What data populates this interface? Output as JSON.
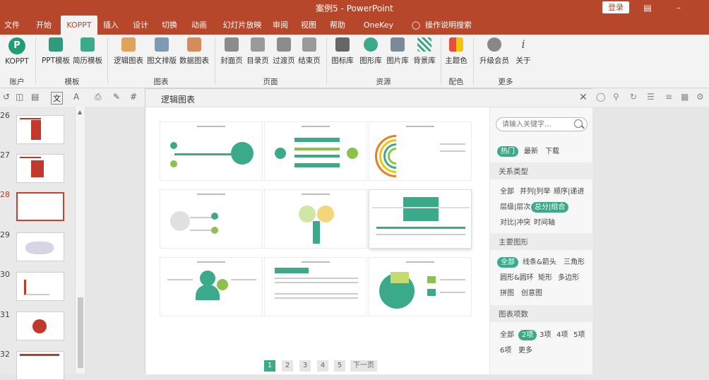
{
  "titlebar": {
    "title": "案例5 - PowerPoint",
    "login": "登录"
  },
  "tabs": [
    {
      "label": "文件"
    },
    {
      "label": "开始"
    },
    {
      "label": "KOPPT"
    },
    {
      "label": "插入"
    },
    {
      "label": "设计"
    },
    {
      "label": "切换"
    },
    {
      "label": "动画"
    },
    {
      "label": "幻灯片放映"
    },
    {
      "label": "审阅"
    },
    {
      "label": "视图"
    },
    {
      "label": "帮助"
    },
    {
      "label": "OneKey Lite"
    },
    {
      "label": "操作说明搜索"
    }
  ],
  "ribbon": {
    "account": {
      "btn": "KOPPT",
      "group": "账户"
    },
    "template": {
      "btn1": "PPT模板",
      "btn2": "简历模板",
      "group": "模板"
    },
    "chart": {
      "btn1": "逻辑图表",
      "btn2": "图文排版",
      "btn3": "数据图表",
      "group": "图表"
    },
    "page": {
      "btn1": "封面页",
      "btn2": "目录页",
      "btn3": "过渡页",
      "btn4": "结束页",
      "group": "页面"
    },
    "resource": {
      "btn1": "图标库",
      "btn2": "图形库",
      "btn3": "图片库",
      "btn4": "背景库",
      "group": "资源"
    },
    "color": {
      "btn1": "主题色",
      "group": "配色"
    },
    "more": {
      "btn1": "升级会员",
      "btn2": "关于",
      "group": "更多"
    }
  },
  "colors": {
    "accent": "#b7472a",
    "teal": "#3aaa8a"
  },
  "slides": [
    "26",
    "27",
    "28",
    "29",
    "30",
    "31",
    "32"
  ],
  "dialog": {
    "title": "逻辑图表",
    "search_placeholder": "请输入关键字...",
    "tabs": {
      "hot": "热门",
      "new": "最新",
      "download": "下载"
    },
    "sections": {
      "relation": {
        "title": "关系类型",
        "items": [
          "全部",
          "并列|列举",
          "顺序|递进",
          "层级|层次",
          "总分|组合",
          "对比|冲突",
          "时间轴"
        ]
      },
      "shape": {
        "title": "主要图形",
        "items": [
          "全部",
          "线条&箭头",
          "三角形",
          "圆形&圆环",
          "矩形",
          "多边形",
          "拼图",
          "创意图"
        ]
      },
      "count": {
        "title": "图表项数",
        "items": [
          "全部",
          "2项",
          "3项",
          "4项",
          "5项",
          "6项",
          "更多"
        ]
      }
    },
    "pager": {
      "pages": [
        "1",
        "2",
        "3",
        "4",
        "5"
      ],
      "next": "下一页"
    }
  }
}
